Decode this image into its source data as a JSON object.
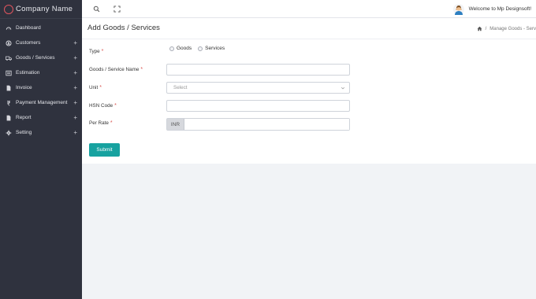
{
  "brand": {
    "name": "Company  Name",
    "accent": "#e0555e"
  },
  "sidebar": {
    "items": [
      {
        "label": "Dashboard",
        "icon": "dashboard-icon",
        "expandable": false
      },
      {
        "label": "Customers",
        "icon": "customers-icon",
        "expandable": true
      },
      {
        "label": "Goods / Services",
        "icon": "truck-icon",
        "expandable": true
      },
      {
        "label": "Estimation",
        "icon": "estimation-icon",
        "expandable": true
      },
      {
        "label": "Invoice",
        "icon": "invoice-icon",
        "expandable": true
      },
      {
        "label": "Payment Management",
        "icon": "rupee-icon",
        "expandable": true
      },
      {
        "label": "Report",
        "icon": "report-icon",
        "expandable": true
      },
      {
        "label": "Setting",
        "icon": "gear-icon",
        "expandable": true
      }
    ],
    "expand_symbol": "+"
  },
  "topbar": {
    "welcome": "Welcome to Mp Designsoft!"
  },
  "page": {
    "title": "Add Goods / Services",
    "breadcrumb_sep": "/",
    "breadcrumb_current": "Manage Goods - Serv"
  },
  "form": {
    "type_label": "Type",
    "type_options": [
      "Goods",
      "Services"
    ],
    "name_label": "Goods / Service Name",
    "unit_label": "Unit",
    "unit_value": "Select",
    "hsn_label": "HSN Code",
    "rate_label": "Per Rate",
    "currency": "INR",
    "required_mark": "*",
    "submit_label": "Submit"
  },
  "colors": {
    "sidebar": "#2f323e",
    "primary": "#17a2a0",
    "required": "#d9534f"
  }
}
